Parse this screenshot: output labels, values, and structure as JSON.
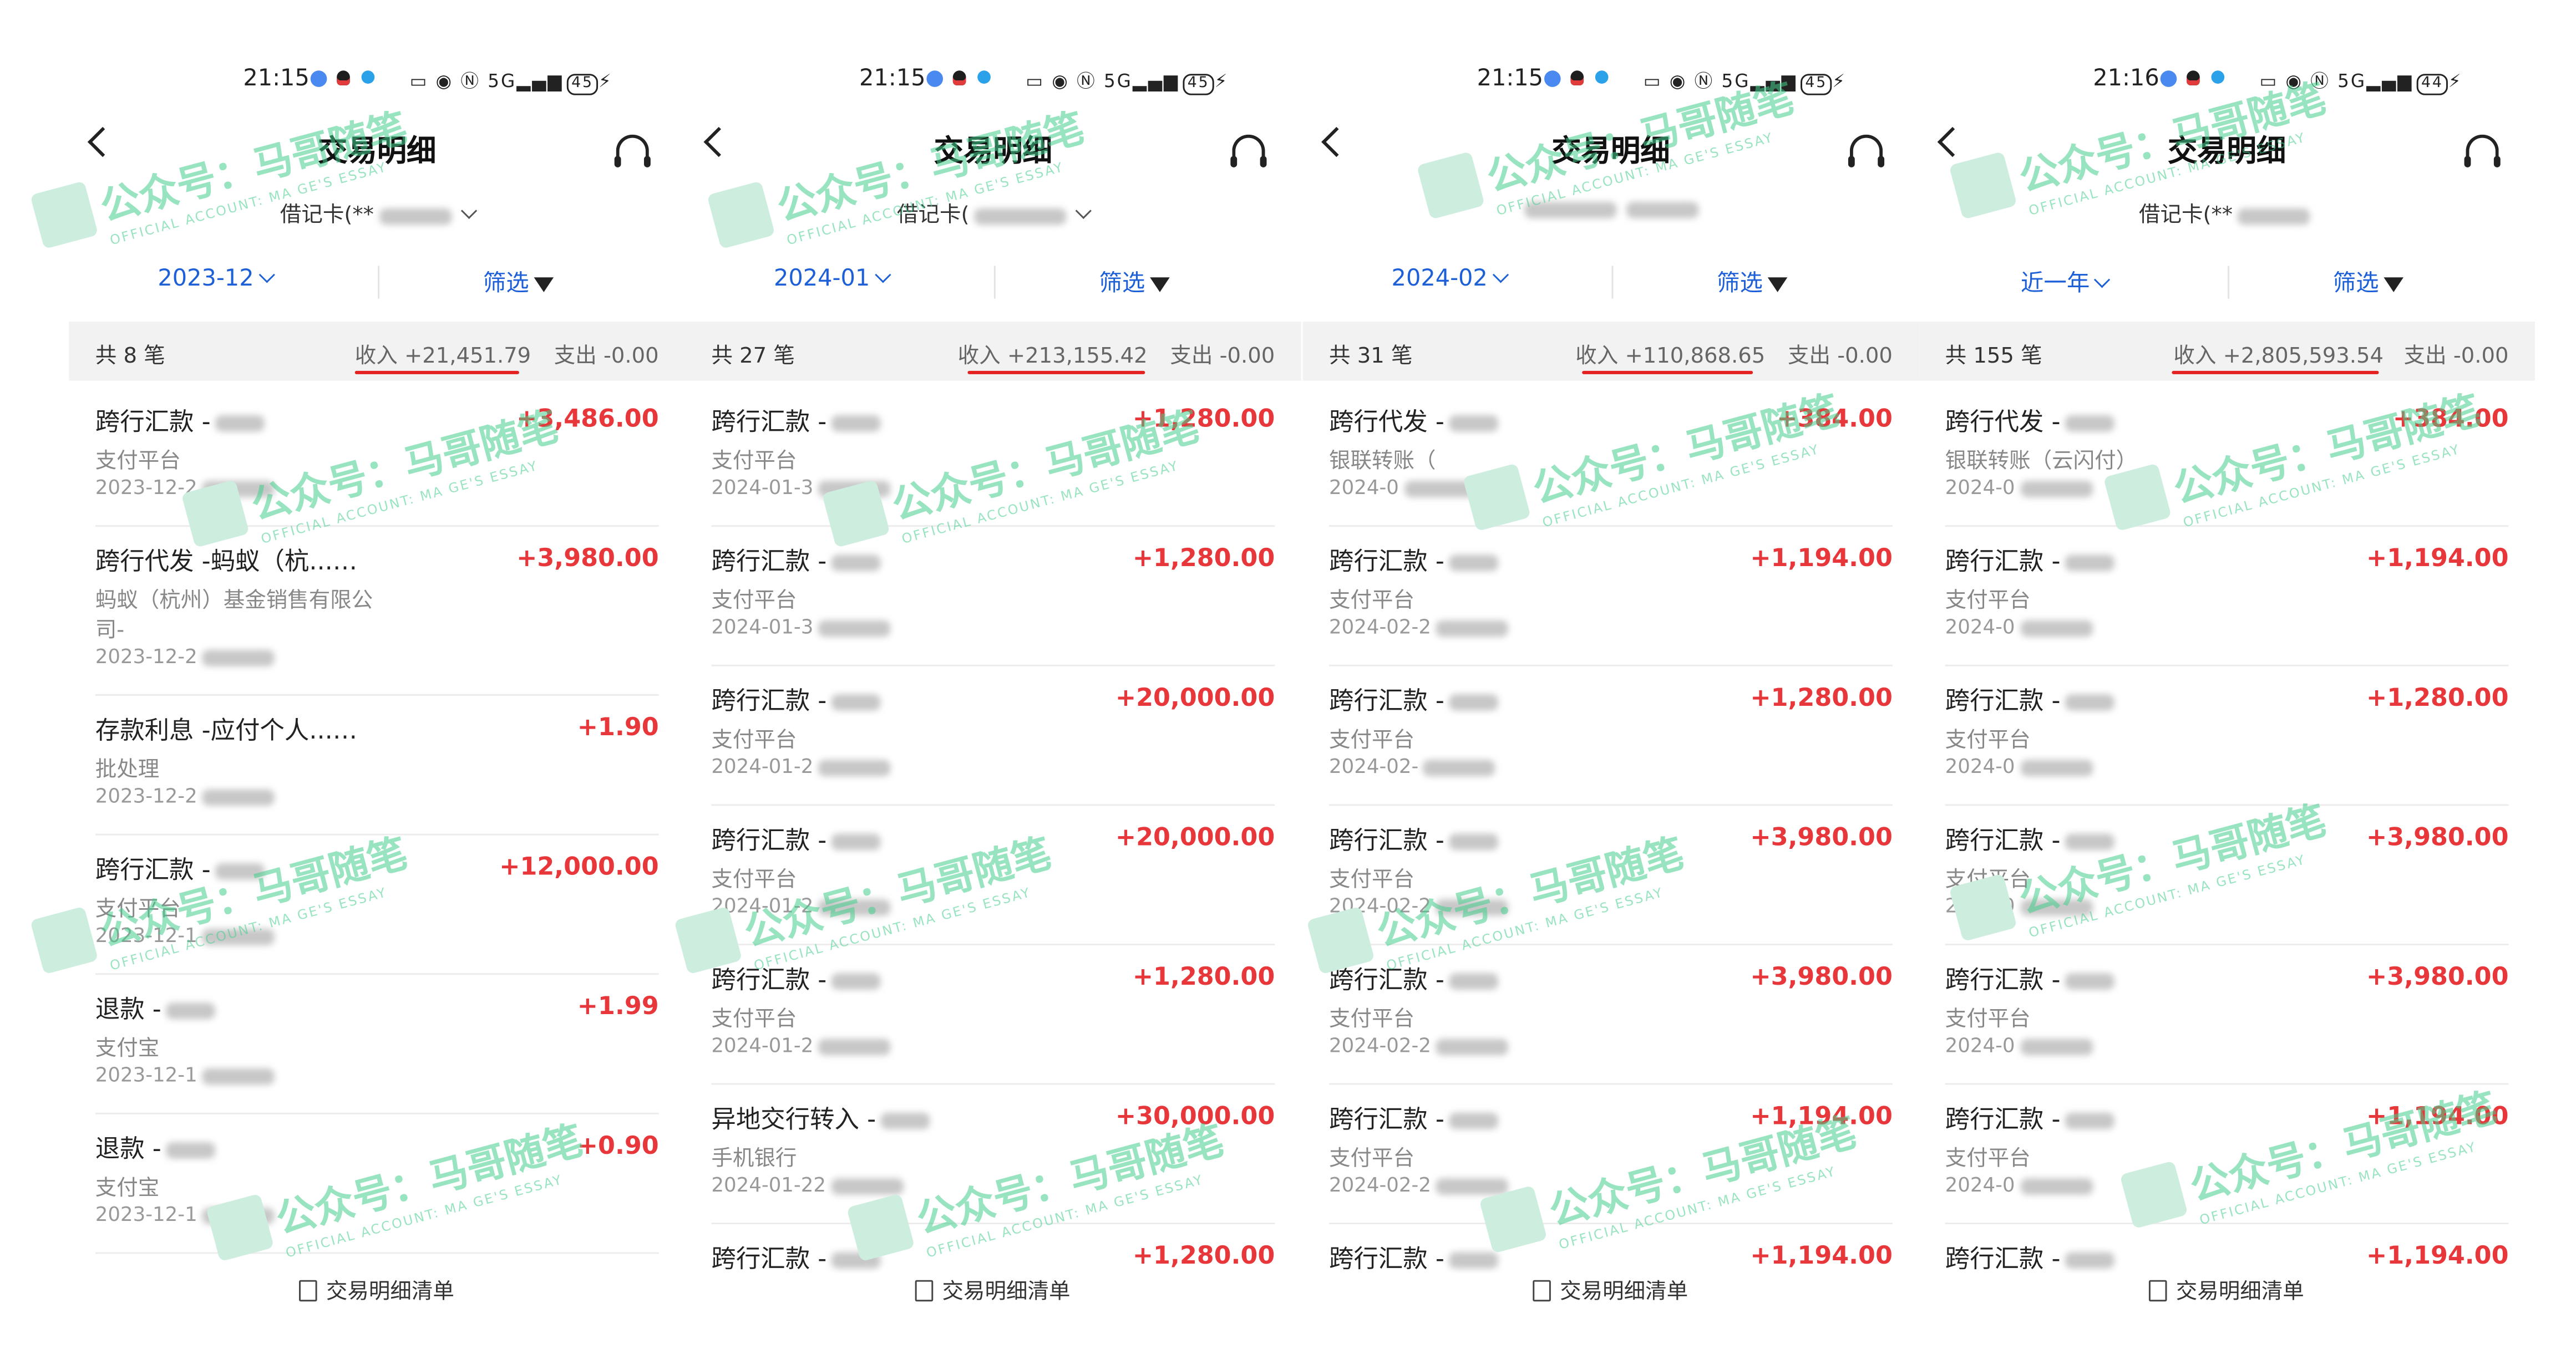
{
  "panels": [
    {
      "status": {
        "time": "21:15",
        "network": "5G",
        "battery": "45"
      },
      "header": {
        "title": "交易明细"
      },
      "card_label": "借记卡(**",
      "month": "2023-12",
      "filter": "筛选",
      "summary": {
        "count": "共 8 笔",
        "income": "收入 +21,451.79",
        "expense": "支出 -0.00"
      },
      "transactions": [
        {
          "name": "跨行汇款 -",
          "sub": "支付平台",
          "sub2": "",
          "date": "2023-12-2",
          "amount": "+3,486.00"
        },
        {
          "name": "跨行代发 -蚂蚁（杭...",
          "sub": "蚂蚁（杭州）基金销售有限公",
          "sub2": "司-",
          "date": "2023-12-2",
          "amount": "+3,980.00"
        },
        {
          "name": "存款利息 -应付个人...",
          "sub": "批处理",
          "sub2": "",
          "date": "2023-12-2",
          "amount": "+1.90"
        },
        {
          "name": "跨行汇款 -",
          "sub": "支付平台",
          "sub2": "",
          "date": "2023-12-1",
          "amount": "+12,000.00"
        },
        {
          "name": "退款 -",
          "sub": "支付宝",
          "sub2": "",
          "date": "2023-12-1",
          "amount": "+1.99"
        },
        {
          "name": "退款 -",
          "sub": "支付宝",
          "sub2": "",
          "date": "2023-12-1",
          "amount": "+0.90"
        }
      ],
      "footer": "交易明细清单"
    },
    {
      "status": {
        "time": "21:15",
        "network": "5G",
        "battery": "45"
      },
      "header": {
        "title": "交易明细"
      },
      "card_label": "借记卡(",
      "month": "2024-01",
      "filter": "筛选",
      "summary": {
        "count": "共 27 笔",
        "income": "收入 +213,155.42",
        "expense": "支出 -0.00"
      },
      "transactions": [
        {
          "name": "跨行汇款 -",
          "sub": "支付平台",
          "sub2": "",
          "date": "2024-01-3",
          "amount": "+1,280.00"
        },
        {
          "name": "跨行汇款 -",
          "sub": "支付平台",
          "sub2": "",
          "date": "2024-01-3",
          "amount": "+1,280.00"
        },
        {
          "name": "跨行汇款 -",
          "sub": "支付平台",
          "sub2": "",
          "date": "2024-01-2",
          "amount": "+20,000.00"
        },
        {
          "name": "跨行汇款 -",
          "sub": "支付平台",
          "sub2": "",
          "date": "2024-01-2",
          "amount": "+20,000.00"
        },
        {
          "name": "跨行汇款 -",
          "sub": "支付平台",
          "sub2": "",
          "date": "2024-01-2",
          "amount": "+1,280.00"
        },
        {
          "name": "异地交行转入 -",
          "sub": "手机银行",
          "sub2": "",
          "date": "2024-01-22",
          "amount": "+30,000.00"
        },
        {
          "name": "跨行汇款 -",
          "sub": "",
          "sub2": "",
          "date": "",
          "amount": "+1,280.00"
        }
      ],
      "footer": "交易明细清单"
    },
    {
      "status": {
        "time": "21:15",
        "network": "5G",
        "battery": "45"
      },
      "header": {
        "title": "交易明细"
      },
      "card_label": "",
      "month": "2024-02",
      "filter": "筛选",
      "summary": {
        "count": "共 31 笔",
        "income": "收入 +110,868.65",
        "expense": "支出 -0.00"
      },
      "transactions": [
        {
          "name": "跨行代发 -",
          "sub": "银联转账（",
          "sub2": "",
          "date": "2024-0",
          "amount": "+384.00"
        },
        {
          "name": "跨行汇款 -",
          "sub": "支付平台",
          "sub2": "",
          "date": "2024-02-2",
          "amount": "+1,194.00"
        },
        {
          "name": "跨行汇款 -",
          "sub": "支付平台",
          "sub2": "",
          "date": "2024-02-",
          "amount": "+1,280.00"
        },
        {
          "name": "跨行汇款 -",
          "sub": "支付平台",
          "sub2": "",
          "date": "2024-02-2",
          "amount": "+3,980.00"
        },
        {
          "name": "跨行汇款 -",
          "sub": "支付平台",
          "sub2": "",
          "date": "2024-02-2",
          "amount": "+3,980.00"
        },
        {
          "name": "跨行汇款 -",
          "sub": "支付平台",
          "sub2": "",
          "date": "2024-02-2",
          "amount": "+1,194.00"
        },
        {
          "name": "跨行汇款 -",
          "sub": "",
          "sub2": "",
          "date": "",
          "amount": "+1,194.00"
        }
      ],
      "footer": "交易明细清单"
    },
    {
      "status": {
        "time": "21:16",
        "network": "5G",
        "battery": "44"
      },
      "header": {
        "title": "交易明细"
      },
      "card_label": "借记卡(**",
      "month": "近一年",
      "filter": "筛选",
      "summary": {
        "count": "共 155 笔",
        "income": "收入 +2,805,593.54",
        "expense": "支出 -0.00"
      },
      "transactions": [
        {
          "name": "跨行代发 -",
          "sub": "银联转账（云闪付）",
          "sub2": "",
          "date": "2024-0",
          "amount": "+384.00"
        },
        {
          "name": "跨行汇款 -",
          "sub": "支付平台",
          "sub2": "",
          "date": "2024-0",
          "amount": "+1,194.00"
        },
        {
          "name": "跨行汇款 -",
          "sub": "支付平台",
          "sub2": "",
          "date": "2024-0",
          "amount": "+1,280.00"
        },
        {
          "name": "跨行汇款 -",
          "sub": "支付平台",
          "sub2": "",
          "date": "2024-0",
          "amount": "+3,980.00"
        },
        {
          "name": "跨行汇款 -",
          "sub": "支付平台",
          "sub2": "",
          "date": "2024-0",
          "amount": "+3,980.00"
        },
        {
          "name": "跨行汇款 -",
          "sub": "支付平台",
          "sub2": "",
          "date": "2024-0",
          "amount": "+1,194.00"
        },
        {
          "name": "跨行汇款 -",
          "sub": "",
          "sub2": "",
          "date": "",
          "amount": "+1,194.00"
        }
      ],
      "footer": "交易明细清单"
    }
  ],
  "watermark": {
    "cn": "公众号：马哥随笔",
    "en": "OFFICIAL ACCOUNT: MA GE'S ESSAY"
  },
  "colors": {
    "accent": "#1d5fd6",
    "income": "#e8373b",
    "highlight": "#e52020",
    "watermark": "#46cd8c"
  }
}
